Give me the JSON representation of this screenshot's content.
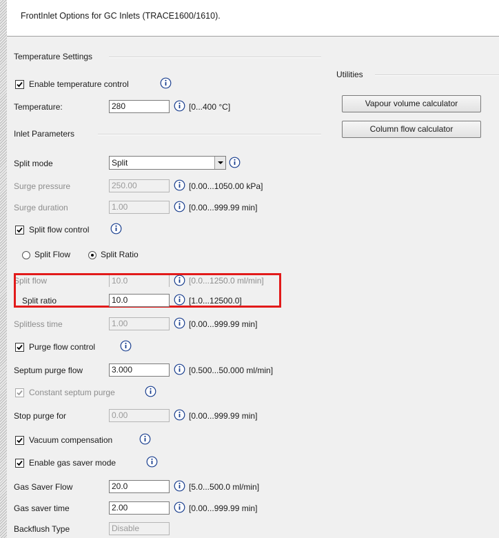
{
  "window": {
    "title": "FrontInlet Options for GC Inlets (TRACE1600/1610)."
  },
  "temperature": {
    "group_title": "Temperature Settings",
    "enable_label": "Enable temperature control",
    "enable_checked": true,
    "temp_label": "Temperature:",
    "temp_value": "280",
    "temp_range": "[0...400 °C]"
  },
  "inlet": {
    "group_title": "Inlet Parameters",
    "split_mode_label": "Split mode",
    "split_mode_value": "Split",
    "surge_pressure_label": "Surge pressure",
    "surge_pressure_value": "250.00",
    "surge_pressure_range": "[0.00...1050.00 kPa]",
    "surge_duration_label": "Surge duration",
    "surge_duration_value": "1.00",
    "surge_duration_range": "[0.00...999.99 min]",
    "split_flow_control_label": "Split flow control",
    "split_flow_control_checked": true,
    "radio_split_flow": "Split Flow",
    "radio_split_ratio": "Split Ratio",
    "selected_radio": "Split Ratio",
    "split_flow_label": "Split flow",
    "split_flow_value": "10.0",
    "split_flow_range": "[0.0...1250.0 ml/min]",
    "split_ratio_label": "Split ratio",
    "split_ratio_value": "10.0",
    "split_ratio_range": "[1.0...12500.0]",
    "splitless_time_label": "Splitless time",
    "splitless_time_value": "1.00",
    "splitless_time_range": "[0.00...999.99 min]",
    "purge_flow_control_label": "Purge flow control",
    "purge_flow_control_checked": true,
    "septum_purge_label": "Septum purge flow",
    "septum_purge_value": "3.000",
    "septum_purge_range": "[0.500...50.000 ml/min]",
    "constant_septum_label": "Constant septum purge",
    "constant_septum_checked": true,
    "stop_purge_label": "Stop purge for",
    "stop_purge_value": "0.00",
    "stop_purge_range": "[0.00...999.99 min]",
    "vacuum_label": "Vacuum compensation",
    "vacuum_checked": true,
    "gas_saver_mode_label": "Enable gas saver mode",
    "gas_saver_mode_checked": true,
    "gas_saver_flow_label": "Gas Saver Flow",
    "gas_saver_flow_value": "20.0",
    "gas_saver_flow_range": "[5.0...500.0 ml/min]",
    "gas_saver_time_label": "Gas saver time",
    "gas_saver_time_value": "2.00",
    "gas_saver_time_range": "[0.00...999.99 min]",
    "backflush_label": "Backflush Type",
    "backflush_value": "Disable"
  },
  "utilities": {
    "group_title": "Utilities",
    "vapour_button": "Vapour volume calculator",
    "column_button": "Column flow calculator"
  },
  "colors": {
    "highlight": "#e21a1a",
    "panel_bg": "#f0f0f0",
    "info_icon": "#1a3f8f"
  }
}
